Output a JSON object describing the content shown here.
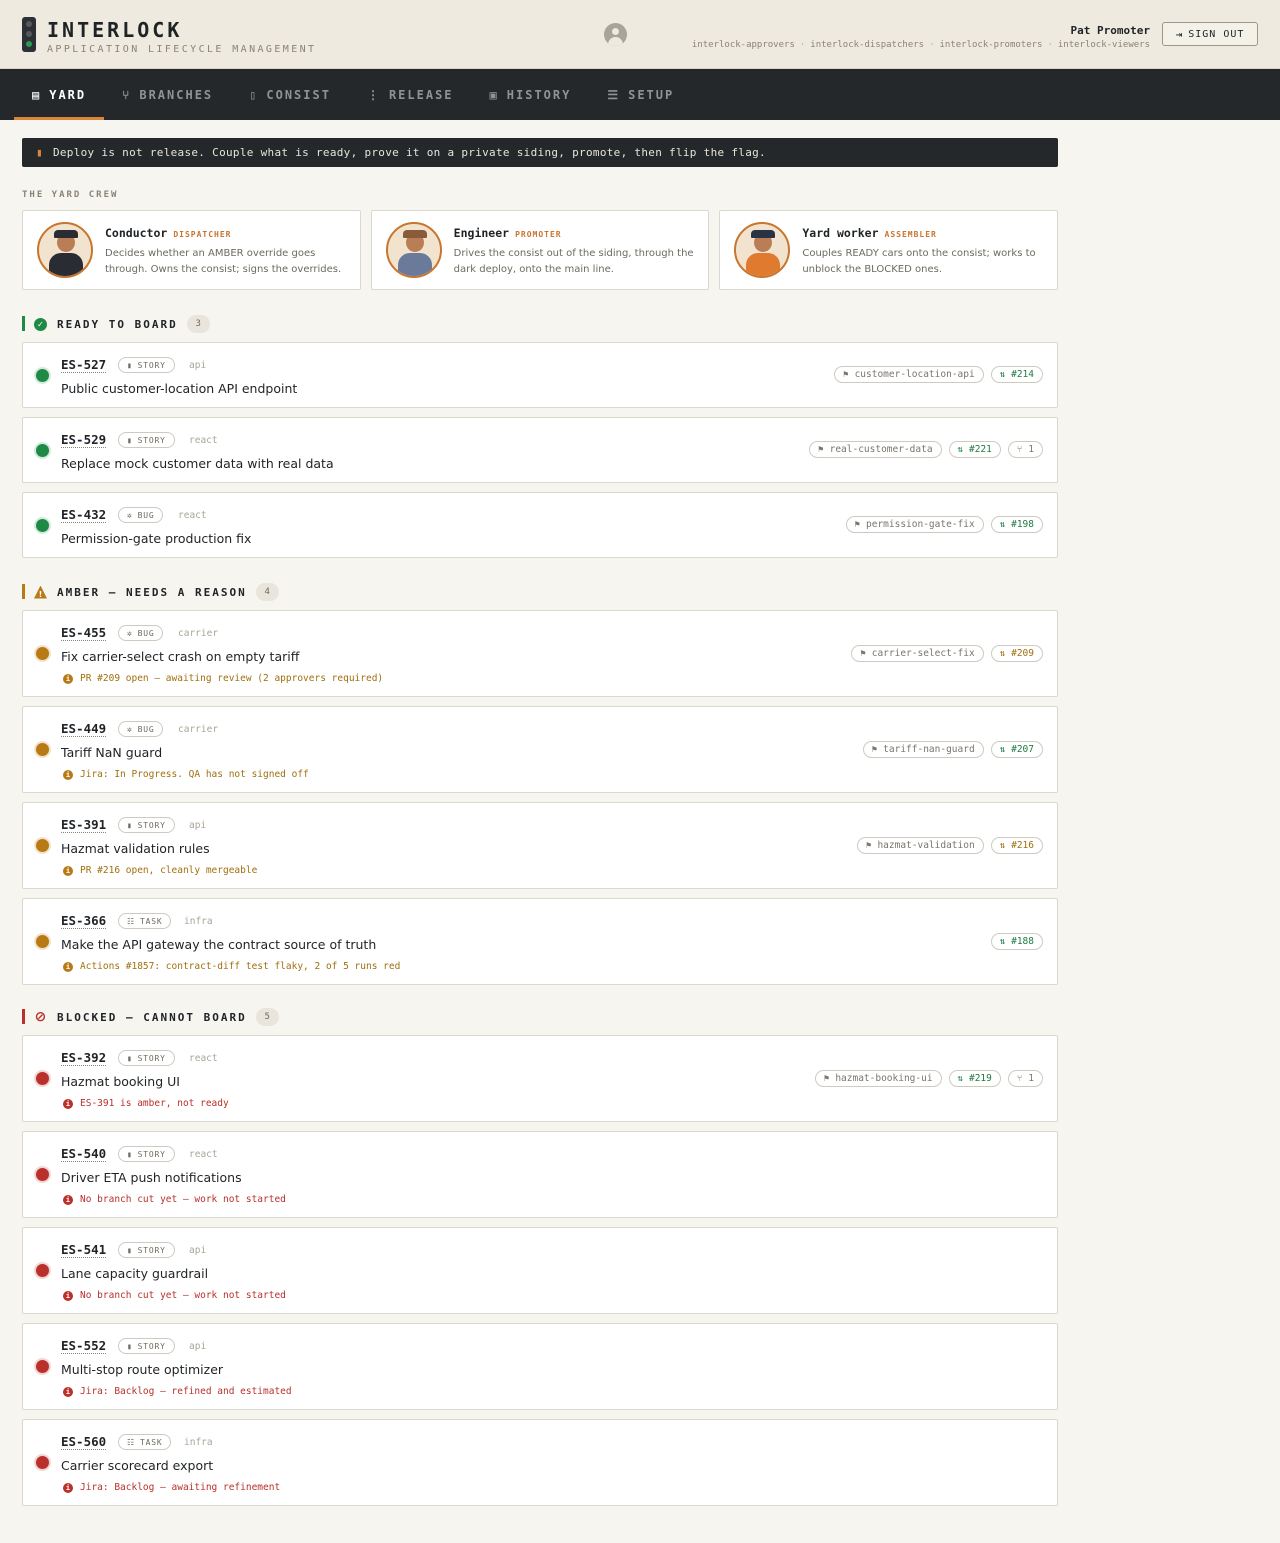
{
  "app": {
    "title": "INTERLOCK",
    "subtitle": "APPLICATION LIFECYCLE MANAGEMENT"
  },
  "user": {
    "name": "Pat Promoter",
    "groups": [
      "interlock-approvers",
      "interlock-dispatchers",
      "interlock-promoters",
      "interlock-viewers"
    ],
    "signout_label": "SIGN OUT"
  },
  "nav": {
    "items": [
      {
        "label": "YARD",
        "icon": "yard-icon"
      },
      {
        "label": "BRANCHES",
        "icon": "branch-icon"
      },
      {
        "label": "CONSIST",
        "icon": "train-icon"
      },
      {
        "label": "RELEASE",
        "icon": "signal-icon"
      },
      {
        "label": "HISTORY",
        "icon": "archive-icon"
      },
      {
        "label": "SETUP",
        "icon": "sliders-icon"
      }
    ],
    "active": "YARD"
  },
  "banner": {
    "text": "Deploy is not release. Couple what is ready, prove it on a private siding, promote, then flip the flag."
  },
  "crew": {
    "label": "THE YARD CREW",
    "members": [
      {
        "name": "Conductor",
        "role": "DISPATCHER",
        "desc": "Decides whether an AMBER override goes through. Owns the consist; signs the overrides."
      },
      {
        "name": "Engineer",
        "role": "PROMOTER",
        "desc": "Drives the consist out of the siding, through the dark deploy, onto the main line."
      },
      {
        "name": "Yard worker",
        "role": "ASSEMBLER",
        "desc": "Couples READY cars onto the consist; works to unblock the BLOCKED ones."
      }
    ]
  },
  "sections": {
    "ready": {
      "title": "READY TO BOARD",
      "count": "3",
      "items": [
        {
          "key": "ES-527",
          "type": "STORY",
          "component": "api",
          "title": "Public customer-location API endpoint",
          "branch": "customer-location-api",
          "pr": "#214"
        },
        {
          "key": "ES-529",
          "type": "STORY",
          "component": "react",
          "title": "Replace mock customer data with real data",
          "branch": "real-customer-data",
          "pr": "#221",
          "deps": "1"
        },
        {
          "key": "ES-432",
          "type": "BUG",
          "component": "react",
          "title": "Permission-gate production fix",
          "branch": "permission-gate-fix",
          "pr": "#198"
        }
      ]
    },
    "amber": {
      "title": "AMBER — NEEDS A REASON",
      "count": "4",
      "items": [
        {
          "key": "ES-455",
          "type": "BUG",
          "component": "carrier",
          "title": "Fix carrier-select crash on empty tariff",
          "reason": "PR #209 open — awaiting review (2 approvers required)",
          "branch": "carrier-select-fix",
          "pr": "#209"
        },
        {
          "key": "ES-449",
          "type": "BUG",
          "component": "carrier",
          "title": "Tariff NaN guard",
          "reason": "Jira: In Progress. QA has not signed off",
          "branch": "tariff-nan-guard",
          "pr": "#207"
        },
        {
          "key": "ES-391",
          "type": "STORY",
          "component": "api",
          "title": "Hazmat validation rules",
          "reason": "PR #216 open, cleanly mergeable",
          "branch": "hazmat-validation",
          "pr": "#216"
        },
        {
          "key": "ES-366",
          "type": "TASK",
          "component": "infra",
          "title": "Make the API gateway the contract source of truth",
          "reason": "Actions #1857: contract-diff test flaky, 2 of 5 runs red",
          "pr": "#188"
        }
      ]
    },
    "blocked": {
      "title": "BLOCKED — CANNOT BOARD",
      "count": "5",
      "items": [
        {
          "key": "ES-392",
          "type": "STORY",
          "component": "react",
          "title": "Hazmat booking UI",
          "reason": "ES-391 is amber, not ready",
          "branch": "hazmat-booking-ui",
          "pr": "#219",
          "deps": "1"
        },
        {
          "key": "ES-540",
          "type": "STORY",
          "component": "react",
          "title": "Driver ETA push notifications",
          "reason": "No branch cut yet — work not started"
        },
        {
          "key": "ES-541",
          "type": "STORY",
          "component": "api",
          "title": "Lane capacity guardrail",
          "reason": "No branch cut yet — work not started"
        },
        {
          "key": "ES-552",
          "type": "STORY",
          "component": "api",
          "title": "Multi-stop route optimizer",
          "reason": "Jira: Backlog — refined and estimated"
        },
        {
          "key": "ES-560",
          "type": "TASK",
          "component": "infra",
          "title": "Carrier scorecard export",
          "reason": "Jira: Backlog — awaiting refinement"
        }
      ]
    }
  },
  "colors": {
    "accent": "#d7863a",
    "ready": "#1f8a47",
    "amber": "#b87a16",
    "blocked": "#b9312a",
    "nav_bg": "#24282b",
    "header_bg": "#eeeadf"
  }
}
